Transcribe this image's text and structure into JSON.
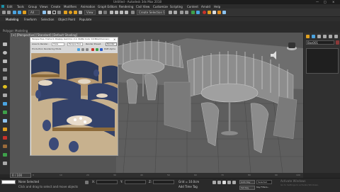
{
  "title_bar": {
    "title": "Untitled - Autodesk 3ds Max 2018",
    "minimize": "—",
    "maximize": "□",
    "close": "×"
  },
  "menu": {
    "items": [
      "Edit",
      "Tools",
      "Group",
      "Views",
      "Create",
      "Modifiers",
      "Animation",
      "Graph Editors",
      "Rendering",
      "Civil View",
      "Customize",
      "Scripting",
      "Content",
      "Arnold",
      "Help"
    ]
  },
  "main_toolbar": {
    "filter": "All",
    "view": "View",
    "selection_set": "Create Selection Set",
    "colors": {
      "accent": "#4aa3e0",
      "warn": "#e0a020",
      "red": "#c8322a",
      "green": "#3ea04a"
    }
  },
  "ribbon": {
    "label": "Modeling",
    "tabs": [
      "Freeform",
      "Selection",
      "Object Paint",
      "Populate"
    ]
  },
  "ribbon_sub": {
    "label": "Polygon Modeling"
  },
  "viewport": {
    "label": "[+] [Perspective] [Standard] [Default Shading]"
  },
  "render_window": {
    "title": "Perspective, frame 0, Display Gamma: 2.2, RGBA Color 16 Bits/Channel (1:1)",
    "area_label": "Area to Render:",
    "area_value": "View",
    "viewport_value": "Perspective",
    "render_preset": "Render Preset:",
    "production": "Production Rendering Mode",
    "render_button": "Render",
    "channel": "RGB Alpha"
  },
  "command_panel": {
    "tabs": [
      "Create",
      "Modify",
      "Hierarchy",
      "Motion",
      "Display",
      "Utilities"
    ],
    "name": "Box001"
  },
  "timeline": {
    "frame": "0 / 100",
    "ticks": [
      "0",
      "5",
      "10",
      "15",
      "20",
      "25",
      "30",
      "35",
      "40",
      "45",
      "50",
      "55",
      "60",
      "65",
      "70",
      "75",
      "80",
      "85",
      "90",
      "95",
      "100"
    ]
  },
  "status": {
    "selected": "None Selected",
    "prompt": "Click and drag to select and move objects",
    "x_label": "X:",
    "y_label": "Y:",
    "z_label": "Z:",
    "grid": "Grid = 10.0cm",
    "add_time_tag": "Add Time Tag",
    "auto_key": "Auto Key",
    "set_key": "Set Key",
    "selected_filter": "Selected",
    "key_filters": "Key Filters...",
    "watermark_1": "Activate Windows",
    "watermark_2": "Go to Settings to activate Windows."
  }
}
